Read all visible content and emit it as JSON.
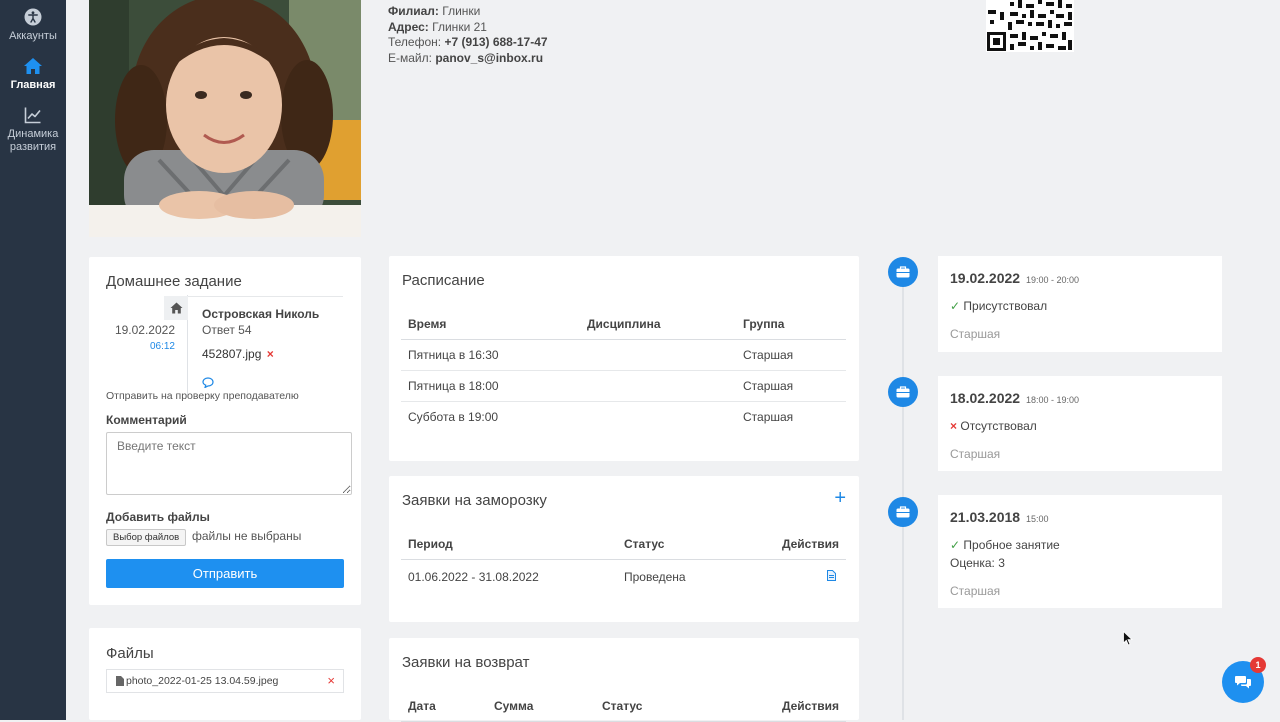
{
  "sidebar": {
    "items": [
      {
        "label": "Аккаунты",
        "icon": "accessibility-icon"
      },
      {
        "label": "Главная",
        "icon": "home-icon",
        "active": true
      },
      {
        "label": "Динамика развития",
        "icon": "chart-line-icon"
      }
    ]
  },
  "profile": {
    "branch_label": "Филиал:",
    "branch": "Глинки",
    "address_label": "Адрес:",
    "address": "Глинки 21",
    "phone_label": "Телефон:",
    "phone": "+7 (913) 688-17-47",
    "email_label": "E-майл:",
    "email": "panov_s@inbox.ru"
  },
  "homework": {
    "title": "Домашнее задание",
    "date": "19.02.2022",
    "time": "06:12",
    "author": "Островская Николь",
    "answer": "Ответ 54",
    "file": "452807.jpg",
    "send_to_teacher": "Отправить на проверку преподавателю",
    "comment_label": "Комментарий",
    "comment_placeholder": "Введите текст",
    "add_files_label": "Добавить файлы",
    "choose_files": "Выбор файлов",
    "no_files": "файлы не выбраны",
    "submit": "Отправить"
  },
  "files": {
    "title": "Файлы",
    "items": [
      "photo_2022-01-25 13.04.59.jpeg"
    ]
  },
  "schedule": {
    "title": "Расписание",
    "columns": [
      "Время",
      "Дисциплина",
      "Группа"
    ],
    "rows": [
      [
        "Пятница в 16:30",
        "",
        "Старшая"
      ],
      [
        "Пятница в 18:00",
        "",
        "Старшая"
      ],
      [
        "Суббота в 19:00",
        "",
        "Старшая"
      ]
    ]
  },
  "freeze": {
    "title": "Заявки на заморозку",
    "columns": [
      "Период",
      "Статус",
      "Действия"
    ],
    "rows": [
      [
        "01.06.2022 - 31.08.2022",
        "Проведена"
      ]
    ]
  },
  "refund": {
    "title": "Заявки на возврат",
    "columns": [
      "Дата",
      "Сумма",
      "Статус",
      "Действия"
    ]
  },
  "timeline": [
    {
      "date": "19.02.2022",
      "time": "19:00 - 20:00",
      "status": "Присутствовал",
      "status_icon": "check-icon",
      "group": "Старшая"
    },
    {
      "date": "18.02.2022",
      "time": "18:00 - 19:00",
      "status": "Отсутствовал",
      "status_icon": "cross-icon",
      "group": "Старшая"
    },
    {
      "date": "21.03.2018",
      "time": "15:00",
      "status": "Пробное занятие",
      "status_icon": "check-icon",
      "grade": "Оценка: 3",
      "group": "Старшая"
    }
  ],
  "chat": {
    "badge": "1"
  },
  "colors": {
    "accent": "#1e90f0",
    "sidebar": "#283444",
    "danger": "#e53935",
    "background": "#f0f1f3"
  }
}
